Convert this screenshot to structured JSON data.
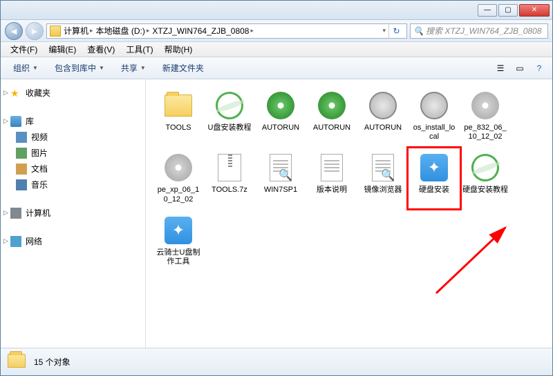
{
  "titlebar": {
    "min": "—",
    "max": "▢",
    "close": "✕"
  },
  "breadcrumb": {
    "seg1": "计算机",
    "seg2": "本地磁盘 (D:)",
    "seg3": "XTZJ_WIN764_ZJB_0808"
  },
  "search": {
    "placeholder": "搜索 XTZJ_WIN764_ZJB_0808"
  },
  "menu": {
    "file": "文件(F)",
    "edit": "编辑(E)",
    "view": "查看(V)",
    "tools": "工具(T)",
    "help": "帮助(H)"
  },
  "toolbar": {
    "organize": "组织",
    "include": "包含到库中",
    "share": "共享",
    "newfolder": "新建文件夹"
  },
  "sidebar": {
    "favorites": "收藏夹",
    "libraries": "库",
    "videos": "视频",
    "pictures": "图片",
    "documents": "文档",
    "music": "音乐",
    "computer": "计算机",
    "network": "网络"
  },
  "files": [
    {
      "name": "TOOLS",
      "type": "folder"
    },
    {
      "name": "U盘安装教程",
      "type": "ie"
    },
    {
      "name": "AUTORUN",
      "type": "disc"
    },
    {
      "name": "AUTORUN",
      "type": "disc"
    },
    {
      "name": "AUTORUN",
      "type": "gear"
    },
    {
      "name": "os_install_local",
      "type": "gear"
    },
    {
      "name": "pe_832_06_10_12_02",
      "type": "disc-gray"
    },
    {
      "name": "pe_xp_06_10_12_02",
      "type": "disc-gray"
    },
    {
      "name": "TOOLS.7z",
      "type": "zip"
    },
    {
      "name": "WIN7SP1",
      "type": "txt-mag"
    },
    {
      "name": "版本说明",
      "type": "txt"
    },
    {
      "name": "镜像浏览器",
      "type": "txt-mag"
    },
    {
      "name": "硬盘安装",
      "type": "blue-app",
      "highlight": true
    },
    {
      "name": "硬盘安装教程",
      "type": "ie"
    },
    {
      "name": "云骑士U盘制作工具",
      "type": "blue-app"
    }
  ],
  "status": {
    "count": "15 个对象"
  }
}
